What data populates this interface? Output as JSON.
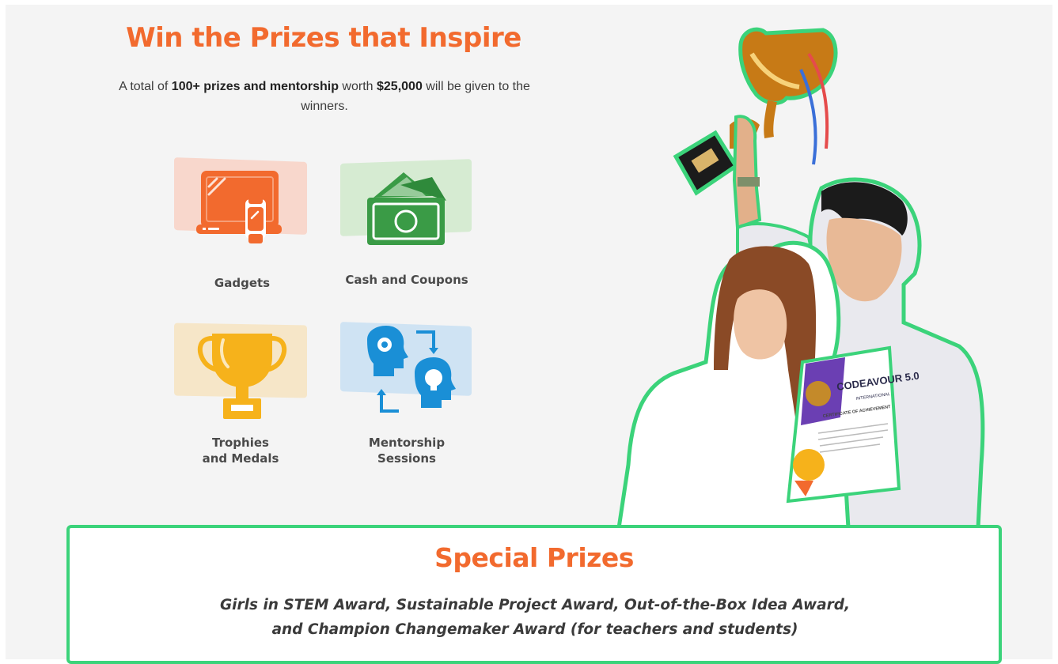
{
  "prizes": {
    "heading": "Win the Prizes that Inspire",
    "lead": {
      "prefix": "A total of ",
      "highlight": "100+ prizes and mentorship",
      "middle": " worth ",
      "amount": "$25,000",
      "suffix": " will be given to the winners."
    },
    "categories": [
      {
        "label": "Gadgets",
        "icon": "laptop-smartwatch-icon",
        "accent": "#f26a2e",
        "tint": "#f8d7cc"
      },
      {
        "label": "Cash and Coupons",
        "icon": "cash-icon",
        "accent": "#3a9b46",
        "tint": "#d6ebd2"
      },
      {
        "label": "Trophies and Medals",
        "icon": "trophy-icon",
        "accent": "#f6b21b",
        "tint": "#f6e6c8"
      },
      {
        "label": "Mentorship Sessions",
        "icon": "mentorship-heads-icon",
        "accent": "#1a8fd6",
        "tint": "#cfe3f3"
      }
    ]
  },
  "special": {
    "title": "Special Prizes",
    "description": "Girls in STEM Award, Sustainable Project Award, Out-of-the-Box Idea Award, and Champion Changemaker Award (for teachers and students)"
  },
  "photo": {
    "certificate_title": "CODEAVOUR 5.0",
    "certificate_subtitle": "INTERNATIONAL",
    "certificate_heading": "CERTIFICATE OF ACHIEVEMENT"
  },
  "colors": {
    "accent": "#f26a2e",
    "border": "#3bd37a"
  }
}
